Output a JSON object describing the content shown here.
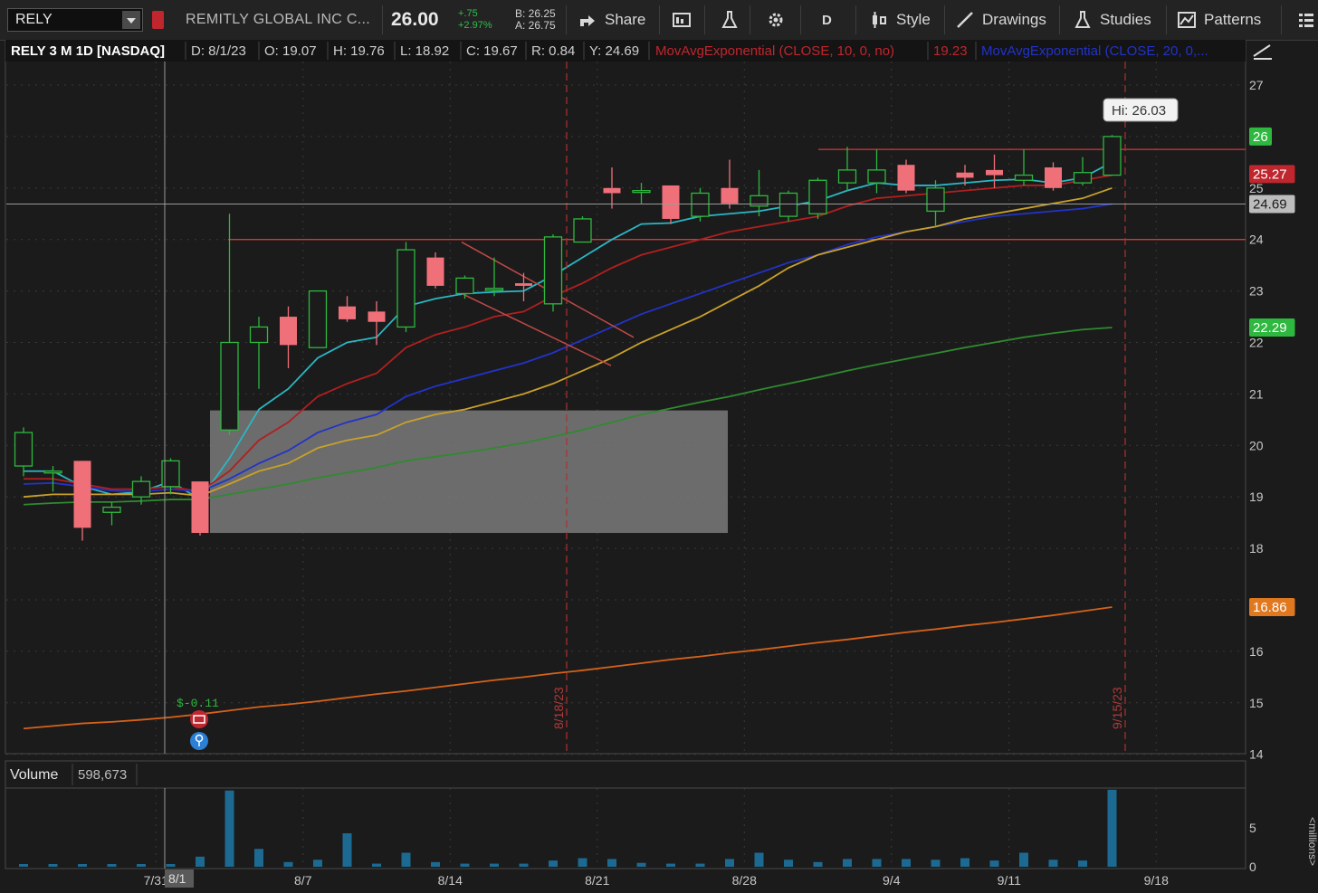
{
  "toolbar": {
    "symbol": "RELY",
    "company": "REMITLY GLOBAL INC C...",
    "last": "26.00",
    "change": "+.75",
    "change_pct": "+2.97%",
    "bid": "B: 26.25",
    "ask": "A: 26.75",
    "share_label": "Share",
    "aggregation": "D",
    "style_label": "Style",
    "drawings_label": "Drawings",
    "studies_label": "Studies",
    "patterns_label": "Patterns"
  },
  "header": {
    "title": "RELY 3 M 1D [NASDAQ]",
    "date": "D: 8/1/23",
    "open": "O: 19.07",
    "high": "H: 19.76",
    "low": "L: 18.92",
    "close": "C: 19.67",
    "range": "R: 0.84",
    "y": "Y: 24.69",
    "ema10_label": "MovAvgExponential (CLOSE, 10, 0, no)",
    "ema10_value": "19.23",
    "ema20_label": "MovAvgExponential (CLOSE, 20, 0,..."
  },
  "volume_panel": {
    "label": "Volume",
    "value": "598,673",
    "axis_unit": "<millions>"
  },
  "annotations": {
    "hi_label": "Hi: 26.03",
    "dividend_label": "$-0.11",
    "vline1_label": "8/18/23",
    "vline2_label": "9/15/23",
    "crosshair_date": "8/1"
  },
  "colors": {
    "up": "#2eb83f",
    "down": "#f0707a",
    "ema10": "#2ab7c4",
    "ema20": "#b21f1f",
    "ema_blue": "#2233c9",
    "ema_gold": "#c9a12a",
    "ema_green": "#2f8a2f",
    "ema_orange": "#d6621a",
    "hline": "#d23a3a"
  },
  "chart_data": {
    "type": "candlestick",
    "title": "RELY 3 M 1D [NASDAQ]",
    "price_axis": {
      "range": [
        14,
        27.5
      ],
      "ticks": [
        14,
        15,
        16,
        18,
        19,
        20,
        21,
        22,
        23,
        24,
        25,
        27
      ]
    },
    "x_tick_labels": [
      "7/31",
      "8/7",
      "8/14",
      "8/21",
      "8/28",
      "9/4",
      "9/11",
      "9/18"
    ],
    "price_markers": [
      {
        "label": "26",
        "value": 26.0,
        "color": "#2eb83f"
      },
      {
        "label": "25.27",
        "value": 25.27,
        "color": "#c0262e"
      },
      {
        "label": "24.69",
        "value": 24.69,
        "color": "#bdbdbd"
      },
      {
        "label": "22.29",
        "value": 22.29,
        "color": "#2eb83f"
      },
      {
        "label": "16.86",
        "value": 16.86,
        "color": "#e07820"
      }
    ],
    "candles": [
      {
        "o": 19.6,
        "h": 20.35,
        "l": 19.4,
        "c": 20.25
      },
      {
        "o": 19.5,
        "h": 19.6,
        "l": 19.1,
        "c": 19.5
      },
      {
        "o": 19.7,
        "h": 19.7,
        "l": 18.15,
        "c": 18.4
      },
      {
        "o": 18.7,
        "h": 18.9,
        "l": 18.45,
        "c": 18.8
      },
      {
        "o": 19.0,
        "h": 19.4,
        "l": 18.85,
        "c": 19.3
      },
      {
        "o": 19.2,
        "h": 19.75,
        "l": 19.05,
        "c": 19.7
      },
      {
        "o": 19.3,
        "h": 19.3,
        "l": 18.25,
        "c": 18.3
      },
      {
        "o": 20.3,
        "h": 24.5,
        "l": 20.2,
        "c": 22.0
      },
      {
        "o": 22.0,
        "h": 22.5,
        "l": 21.1,
        "c": 22.3
      },
      {
        "o": 22.5,
        "h": 22.7,
        "l": 21.5,
        "c": 21.95
      },
      {
        "o": 21.9,
        "h": 23.0,
        "l": 21.9,
        "c": 23.0
      },
      {
        "o": 22.7,
        "h": 22.9,
        "l": 22.4,
        "c": 22.45
      },
      {
        "o": 22.6,
        "h": 22.8,
        "l": 21.95,
        "c": 22.4
      },
      {
        "o": 22.3,
        "h": 23.95,
        "l": 22.2,
        "c": 23.8
      },
      {
        "o": 23.65,
        "h": 23.75,
        "l": 23.05,
        "c": 23.1
      },
      {
        "o": 22.95,
        "h": 23.3,
        "l": 22.85,
        "c": 23.25
      },
      {
        "o": 23.05,
        "h": 23.65,
        "l": 22.9,
        "c": 23.05
      },
      {
        "o": 23.15,
        "h": 23.35,
        "l": 22.8,
        "c": 23.1
      },
      {
        "o": 22.75,
        "h": 24.1,
        "l": 22.6,
        "c": 24.05
      },
      {
        "o": 23.95,
        "h": 24.45,
        "l": 23.95,
        "c": 24.4
      },
      {
        "o": 25.0,
        "h": 25.4,
        "l": 24.6,
        "c": 24.9
      },
      {
        "o": 24.95,
        "h": 25.1,
        "l": 24.7,
        "c": 24.95
      },
      {
        "o": 25.05,
        "h": 25.05,
        "l": 24.3,
        "c": 24.4
      },
      {
        "o": 24.45,
        "h": 25.0,
        "l": 24.35,
        "c": 24.9
      },
      {
        "o": 25.0,
        "h": 25.55,
        "l": 24.6,
        "c": 24.7
      },
      {
        "o": 24.65,
        "h": 25.35,
        "l": 24.45,
        "c": 24.85
      },
      {
        "o": 24.45,
        "h": 24.95,
        "l": 24.35,
        "c": 24.9
      },
      {
        "o": 24.5,
        "h": 25.2,
        "l": 24.4,
        "c": 25.15
      },
      {
        "o": 25.1,
        "h": 25.8,
        "l": 24.95,
        "c": 25.35
      },
      {
        "o": 25.1,
        "h": 25.75,
        "l": 24.9,
        "c": 25.35
      },
      {
        "o": 25.45,
        "h": 25.55,
        "l": 24.9,
        "c": 24.95
      },
      {
        "o": 24.55,
        "h": 25.15,
        "l": 24.25,
        "c": 25.0
      },
      {
        "o": 25.3,
        "h": 25.45,
        "l": 25.05,
        "c": 25.2
      },
      {
        "o": 25.35,
        "h": 25.65,
        "l": 25.0,
        "c": 25.25
      },
      {
        "o": 25.15,
        "h": 25.75,
        "l": 25.05,
        "c": 25.25
      },
      {
        "o": 25.4,
        "h": 25.5,
        "l": 24.95,
        "c": 25.0
      },
      {
        "o": 25.1,
        "h": 25.6,
        "l": 25.05,
        "c": 25.3
      },
      {
        "o": 25.25,
        "h": 26.03,
        "l": 25.25,
        "c": 26.0
      }
    ],
    "ema_series": [
      {
        "color": "#2ab7c4",
        "values": [
          19.5,
          19.5,
          19.2,
          19.05,
          19.1,
          19.3,
          18.95,
          19.75,
          20.7,
          21.1,
          21.7,
          22.0,
          22.1,
          22.7,
          22.85,
          22.95,
          22.98,
          23.0,
          23.3,
          23.65,
          24.0,
          24.3,
          24.32,
          24.45,
          24.5,
          24.55,
          24.65,
          24.75,
          24.95,
          25.1,
          25.05,
          25.05,
          25.1,
          25.15,
          25.17,
          25.1,
          25.2,
          25.5
        ]
      },
      {
        "color": "#b21f1f",
        "values": [
          19.35,
          19.35,
          19.25,
          19.15,
          19.15,
          19.2,
          19.1,
          19.5,
          20.1,
          20.45,
          20.95,
          21.2,
          21.4,
          21.9,
          22.15,
          22.3,
          22.5,
          22.6,
          22.9,
          23.15,
          23.45,
          23.7,
          23.85,
          24.0,
          24.15,
          24.25,
          24.35,
          24.45,
          24.65,
          24.8,
          24.85,
          24.9,
          24.95,
          25.0,
          25.05,
          25.05,
          25.15,
          25.25
        ]
      },
      {
        "color": "#2233c9",
        "values": [
          19.25,
          19.27,
          19.2,
          19.12,
          19.1,
          19.15,
          19.1,
          19.35,
          19.65,
          19.9,
          20.25,
          20.45,
          20.6,
          20.95,
          21.15,
          21.3,
          21.45,
          21.6,
          21.8,
          22.05,
          22.3,
          22.55,
          22.75,
          22.95,
          23.15,
          23.35,
          23.55,
          23.7,
          23.9,
          24.05,
          24.15,
          24.25,
          24.35,
          24.45,
          24.5,
          24.55,
          24.6,
          24.69
        ]
      },
      {
        "color": "#c9a12a",
        "values": [
          19.0,
          19.05,
          19.05,
          19.05,
          19.05,
          19.08,
          19.02,
          19.25,
          19.5,
          19.65,
          19.95,
          20.1,
          20.2,
          20.45,
          20.6,
          20.7,
          20.85,
          21.0,
          21.2,
          21.45,
          21.7,
          22.0,
          22.25,
          22.5,
          22.8,
          23.1,
          23.45,
          23.7,
          23.85,
          24.0,
          24.15,
          24.25,
          24.4,
          24.5,
          24.6,
          24.7,
          24.8,
          25.0
        ]
      },
      {
        "color": "#2f8a2f",
        "values": [
          18.85,
          18.88,
          18.9,
          18.9,
          18.92,
          18.95,
          18.95,
          19.05,
          19.15,
          19.25,
          19.37,
          19.47,
          19.57,
          19.7,
          19.78,
          19.86,
          19.95,
          20.05,
          20.17,
          20.3,
          20.45,
          20.6,
          20.72,
          20.84,
          20.95,
          21.08,
          21.2,
          21.32,
          21.45,
          21.57,
          21.68,
          21.79,
          21.9,
          22.0,
          22.1,
          22.18,
          22.25,
          22.29
        ]
      },
      {
        "color": "#d6621a",
        "values": [
          14.5,
          14.55,
          14.6,
          14.63,
          14.67,
          14.72,
          14.78,
          14.85,
          14.92,
          14.97,
          15.03,
          15.1,
          15.17,
          15.23,
          15.3,
          15.37,
          15.44,
          15.5,
          15.57,
          15.63,
          15.7,
          15.77,
          15.84,
          15.9,
          15.97,
          16.03,
          16.1,
          16.17,
          16.23,
          16.3,
          16.37,
          16.43,
          16.5,
          16.56,
          16.63,
          16.7,
          16.78,
          16.86
        ]
      }
    ],
    "volume": {
      "axis_ticks": [
        0,
        5
      ],
      "values": [
        0.35,
        0.35,
        0.35,
        0.35,
        0.35,
        0.35,
        1.3,
        9.8,
        2.3,
        0.6,
        0.9,
        4.3,
        0.4,
        1.8,
        0.6,
        0.4,
        0.4,
        0.4,
        0.8,
        1.1,
        1.0,
        0.5,
        0.4,
        0.4,
        1.0,
        1.8,
        0.9,
        0.6,
        1.0,
        1.0,
        1.0,
        0.9,
        1.1,
        0.8,
        1.8,
        0.9,
        0.8,
        9.9
      ]
    }
  }
}
